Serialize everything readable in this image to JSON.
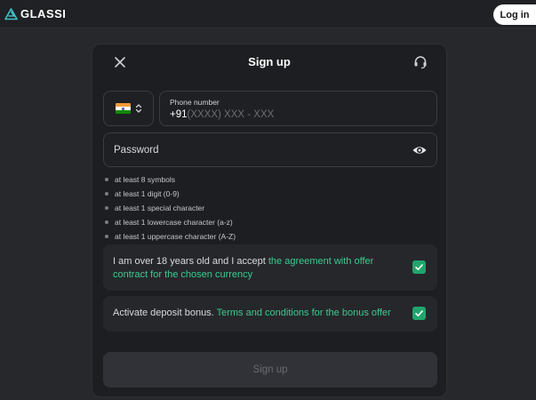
{
  "topbar": {
    "logo_text": "GLASSI",
    "login_label": "Log in"
  },
  "modal": {
    "title": "Sign up",
    "phone": {
      "label": "Phone number",
      "prefix": "+91",
      "placeholder": "(XXXX) XXX - XXX",
      "country_flag": "india-flag-icon"
    },
    "password": {
      "placeholder": "Password"
    },
    "rules": [
      "at least 8 symbols",
      "at least 1 digit (0-9)",
      "at least 1 special character",
      "at least 1 lowercase character (a-z)",
      "at least 1 uppercase character (A-Z)"
    ],
    "agreement": {
      "text": "I am over 18 years old and I accept ",
      "link": "the agreement with offer contract for the chosen currency",
      "checked": true
    },
    "bonus": {
      "text": "Activate deposit bonus. ",
      "link": "Terms and conditions for the bonus offer",
      "checked": true
    },
    "submit_label": "Sign up"
  },
  "colors": {
    "accent": "#3ccb8e",
    "checkbox": "#21a56d",
    "background": "#26282c",
    "modal": "#1c1e21"
  }
}
